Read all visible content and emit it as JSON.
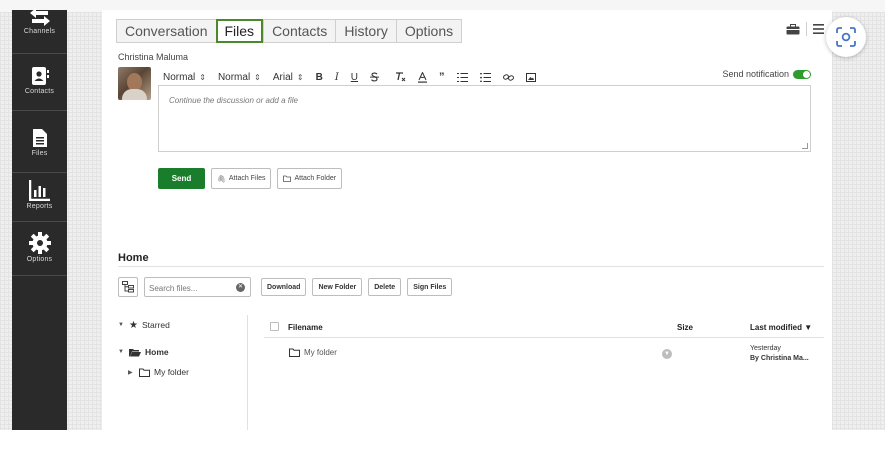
{
  "sidebar": {
    "items": [
      {
        "label": "Channels",
        "icon": "channels-icon"
      },
      {
        "label": "Contacts",
        "icon": "contacts-icon"
      },
      {
        "label": "Files",
        "icon": "files-icon"
      },
      {
        "label": "Reports",
        "icon": "reports-icon"
      },
      {
        "label": "Options",
        "icon": "gear-icon"
      }
    ]
  },
  "tabs": [
    {
      "label": "Conversation",
      "active": false
    },
    {
      "label": "Files",
      "active": true
    },
    {
      "label": "Contacts",
      "active": false
    },
    {
      "label": "History",
      "active": false
    },
    {
      "label": "Options",
      "active": false
    }
  ],
  "composer": {
    "author": "Christina Maluma",
    "toolbar": {
      "heading_select": "Normal",
      "size_select": "Normal",
      "font_select": "Arial",
      "bold": "B",
      "italic": "I",
      "underline": "U",
      "strike": "S",
      "clear_format": "Tx",
      "text_color": "A",
      "quote": "99"
    },
    "send_notification_label": "Send notification",
    "send_notification_on": true,
    "placeholder": "Continue the discussion or add a file",
    "send_label": "Send",
    "attach_files_label": "Attach Files",
    "attach_folder_label": "Attach Folder"
  },
  "files": {
    "title": "Home",
    "search_placeholder": "Search files...",
    "buttons": {
      "download": "Download",
      "new_folder": "New Folder",
      "delete": "Delete",
      "sign_files": "Sign Files"
    },
    "tree": {
      "starred": "Starred",
      "home": "Home",
      "my_folder": "My folder"
    },
    "columns": {
      "filename": "Filename",
      "size": "Size",
      "last_modified": "Last modified ▼"
    },
    "rows": [
      {
        "name": "My folder",
        "size": "",
        "modified_line1": "Yesterday",
        "modified_line2": "By Christina Ma..."
      }
    ]
  },
  "colors": {
    "accent_green": "#1a7d2c",
    "active_tab_border": "#4b8a2c",
    "sidebar_bg": "#2a2a2a"
  }
}
